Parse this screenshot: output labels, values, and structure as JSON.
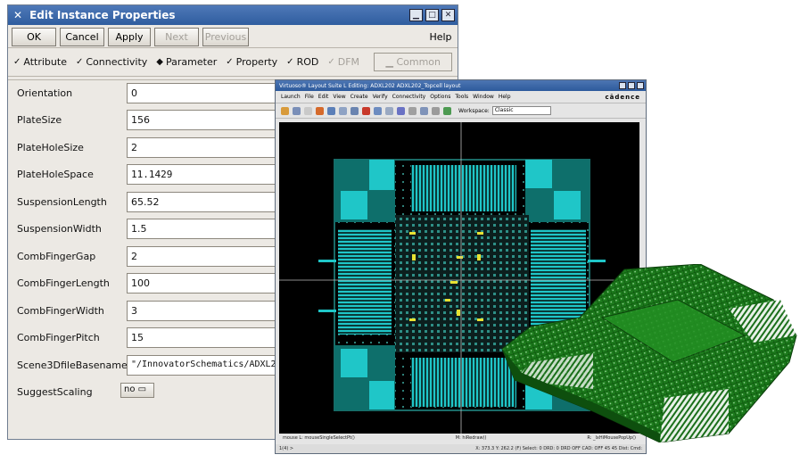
{
  "dialog": {
    "title": "Edit Instance Properties",
    "close_icon": "x-icon",
    "window_controls": [
      "minimize-icon",
      "maximize-icon",
      "close-icon"
    ],
    "buttons": [
      {
        "label": "OK",
        "enabled": true
      },
      {
        "label": "Cancel",
        "enabled": true
      },
      {
        "label": "Apply",
        "enabled": true
      },
      {
        "label": "Next",
        "enabled": false
      },
      {
        "label": "Previous",
        "enabled": false
      }
    ],
    "help_label": "Help",
    "tabs": [
      {
        "label": "Attribute",
        "marker": "check-icon",
        "enabled": true
      },
      {
        "label": "Connectivity",
        "marker": "check-icon",
        "enabled": true
      },
      {
        "label": "Parameter",
        "marker": "diamond-icon",
        "enabled": true
      },
      {
        "label": "Property",
        "marker": "check-icon",
        "enabled": true
      },
      {
        "label": "ROD",
        "marker": "check-icon",
        "enabled": true
      },
      {
        "label": "DFM",
        "marker": "check-icon",
        "enabled": false
      }
    ],
    "common_label": "Common",
    "fields": [
      {
        "label": "Orientation",
        "value": "0"
      },
      {
        "label": "PlateSize",
        "value": "156"
      },
      {
        "label": "PlateHoleSize",
        "value": "2"
      },
      {
        "label": "PlateHoleSpace",
        "value": "11.1429"
      },
      {
        "label": "SuspensionLength",
        "value": "65.52"
      },
      {
        "label": "SuspensionWidth",
        "value": "1.5"
      },
      {
        "label": "CombFingerGap",
        "value": "2"
      },
      {
        "label": "CombFingerLength",
        "value": "100"
      },
      {
        "label": "CombFingerWidth",
        "value": "3"
      },
      {
        "label": "CombFingerPitch",
        "value": "15"
      },
      {
        "label": "Scene3DfileBasename",
        "value": "\"/InnovatorSchematics/ADXL2"
      },
      {
        "label": "SuggestScaling",
        "value": "no"
      }
    ]
  },
  "layout_window": {
    "title": "Virtuoso® Layout Suite L Editing: ADXL202 ADXL202_Topcell layout",
    "menu": [
      "Launch",
      "File",
      "Edit",
      "View",
      "Create",
      "Verify",
      "Connectivity",
      "Options",
      "Tools",
      "Window",
      "Help"
    ],
    "brand": "cādence",
    "workspace_label": "Workspace:",
    "workspace_value": "Classic",
    "status_left": "mouse L: mouseSingleSelectPt()",
    "status_mid": "M: hiRedraw()",
    "status_right": "R: _lxHiMousePopUp()",
    "cmd_prompt": "1(4)  >",
    "cmd_status": "X: 373.3   Y: 262.2   (F) Select: 0   DRD: 0   DRD OFF   CAD: OFF   45 45 Dist: Cmd:"
  },
  "colors": {
    "titlebar": "#2f5d9f",
    "dialog_bg": "#ece9e4",
    "canvas_bg": "#000000",
    "metal_cyan": "#1fc6c8",
    "metal_teal": "#0e6f6b",
    "via_yellow": "#e8e232",
    "mesh_green": "#1c7a1c"
  }
}
